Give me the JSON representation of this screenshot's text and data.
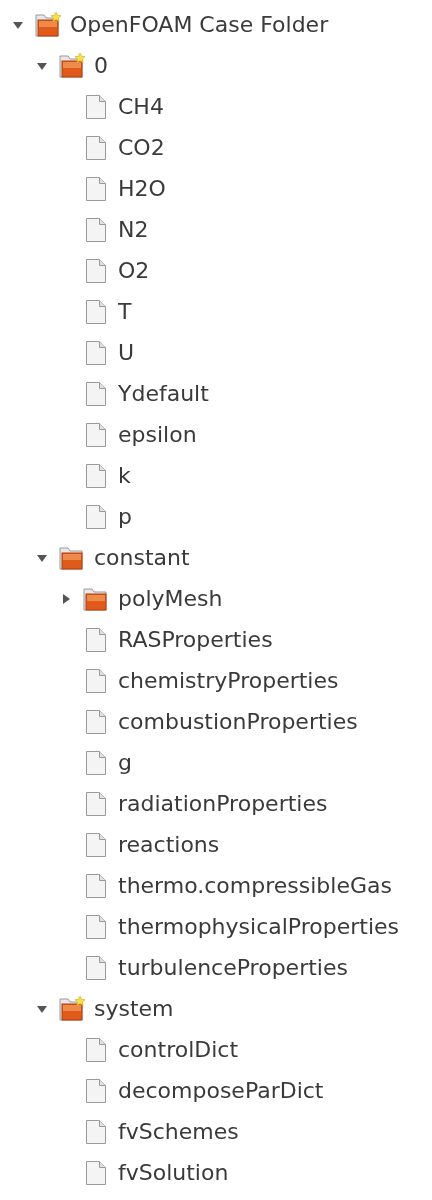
{
  "tree": [
    {
      "kind": "folder",
      "name": "OpenFOAM Case Folder",
      "starred": true,
      "expanded": true,
      "children": [
        {
          "kind": "folder",
          "name": "0",
          "starred": true,
          "expanded": true,
          "children": [
            {
              "kind": "file",
              "name": "CH4"
            },
            {
              "kind": "file",
              "name": "CO2"
            },
            {
              "kind": "file",
              "name": "H2O"
            },
            {
              "kind": "file",
              "name": "N2"
            },
            {
              "kind": "file",
              "name": "O2"
            },
            {
              "kind": "file",
              "name": "T"
            },
            {
              "kind": "file",
              "name": "U"
            },
            {
              "kind": "file",
              "name": "Ydefault"
            },
            {
              "kind": "file",
              "name": "epsilon"
            },
            {
              "kind": "file",
              "name": "k"
            },
            {
              "kind": "file",
              "name": "p"
            }
          ]
        },
        {
          "kind": "folder",
          "name": "constant",
          "starred": false,
          "expanded": true,
          "children": [
            {
              "kind": "folder",
              "name": "polyMesh",
              "starred": false,
              "expanded": false
            },
            {
              "kind": "file",
              "name": "RASProperties"
            },
            {
              "kind": "file",
              "name": "chemistryProperties"
            },
            {
              "kind": "file",
              "name": "combustionProperties"
            },
            {
              "kind": "file",
              "name": "g"
            },
            {
              "kind": "file",
              "name": "radiationProperties"
            },
            {
              "kind": "file",
              "name": "reactions"
            },
            {
              "kind": "file",
              "name": "thermo.compressibleGas"
            },
            {
              "kind": "file",
              "name": "thermophysicalProperties"
            },
            {
              "kind": "file",
              "name": "turbulenceProperties"
            }
          ]
        },
        {
          "kind": "folder",
          "name": "system",
          "starred": true,
          "expanded": true,
          "children": [
            {
              "kind": "file",
              "name": "controlDict"
            },
            {
              "kind": "file",
              "name": "decomposeParDict"
            },
            {
              "kind": "file",
              "name": "fvSchemes"
            },
            {
              "kind": "file",
              "name": "fvSolution"
            }
          ]
        }
      ]
    }
  ]
}
